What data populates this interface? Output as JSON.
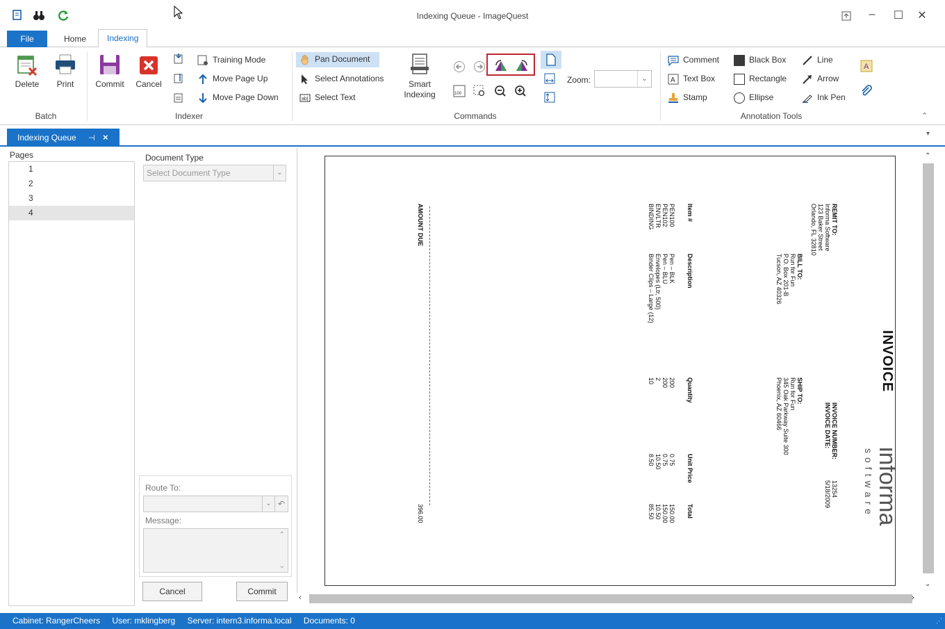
{
  "window": {
    "title": "Indexing Queue - ImageQuest"
  },
  "quick_access": {
    "icons": [
      "scan-icon",
      "binoculars-icon",
      "refresh-icon"
    ]
  },
  "tabs": {
    "file": "File",
    "home": "Home",
    "indexing": "Indexing"
  },
  "ribbon": {
    "batch": {
      "label": "Batch",
      "delete": "Delete",
      "print": "Print"
    },
    "indexer": {
      "label": "Indexer",
      "commit": "Commit",
      "cancel": "Cancel",
      "training_mode": "Training Mode",
      "move_page_up": "Move Page Up",
      "move_page_down": "Move Page Down"
    },
    "commands": {
      "label": "Commands",
      "pan_document": "Pan Document",
      "select_annotations": "Select Annotations",
      "select_text": "Select Text",
      "smart_indexing": "Smart Indexing",
      "zoom_label": "Zoom:",
      "zoom_value": ""
    },
    "annotation_tools": {
      "label": "Annotation Tools",
      "comment": "Comment",
      "text_box": "Text Box",
      "stamp": "Stamp",
      "black_box": "Black Box",
      "rectangle": "Rectangle",
      "ellipse": "Ellipse",
      "line": "Line",
      "arrow": "Arrow",
      "ink_pen": "Ink Pen"
    }
  },
  "doc_tab": {
    "label": "Indexing Queue"
  },
  "pages": {
    "header": "Pages",
    "items": [
      "1",
      "2",
      "3",
      "4"
    ],
    "selected": "4"
  },
  "document_type": {
    "label": "Document Type",
    "placeholder": "Select Document Type"
  },
  "route": {
    "label": "Route To:",
    "value": "",
    "message_label": "Message:",
    "message_value": ""
  },
  "buttons": {
    "cancel": "Cancel",
    "commit": "Commit"
  },
  "invoice": {
    "title": "INVOICE",
    "logo": "informa",
    "logo_sub": "software",
    "remit_to_label": "REMIT TO:",
    "remit_to": [
      "Informa Software",
      "123 Baker Street",
      "Orlando, FL 32810"
    ],
    "bill_to_label": "BILL TO:",
    "bill_to": [
      "Run for Fun",
      "P.O. Box 201-B",
      "Tucson, AZ 40326"
    ],
    "ship_to_label": "SHIP TO:",
    "ship_to": [
      "Run for Fun",
      "345 Oak Parkway Suite 300",
      "Phoenix, AZ 60466"
    ],
    "invoice_number_label": "INVOICE NUMBER:",
    "invoice_number": "13254",
    "invoice_date_label": "INVOICE DATE:",
    "invoice_date": "5/18/2009",
    "columns": {
      "item": "Item #",
      "description": "Description",
      "quantity": "Quantity",
      "unit_price": "Unit Price",
      "total": "Total"
    },
    "rows": [
      {
        "item": "PEN100",
        "description": "Pen – BLK",
        "quantity": "200",
        "unit_price": "0.75",
        "total": "150.00"
      },
      {
        "item": "PEN102",
        "description": "Pen – BLU",
        "quantity": "200",
        "unit_price": "0.75",
        "total": "150.00"
      },
      {
        "item": "ENVLTR",
        "description": "Envelopes (Ltr, 500)",
        "quantity": "2",
        "unit_price": "10.50",
        "total": "10.50"
      },
      {
        "item": "BINDING",
        "description": "Binder Clips – Large (12)",
        "quantity": "10",
        "unit_price": "8.50",
        "total": "85.50"
      }
    ],
    "amount_due_label": "AMOUNT DUE",
    "amount_due": "396.00"
  },
  "status": {
    "cabinet": "Cabinet: RangerCheers",
    "user": "User: mklingberg",
    "server": "Server: intern3.informa.local",
    "documents": "Documents: 0"
  },
  "colors": {
    "accent": "#1a73c8",
    "highlight_box": "#c0282e"
  }
}
